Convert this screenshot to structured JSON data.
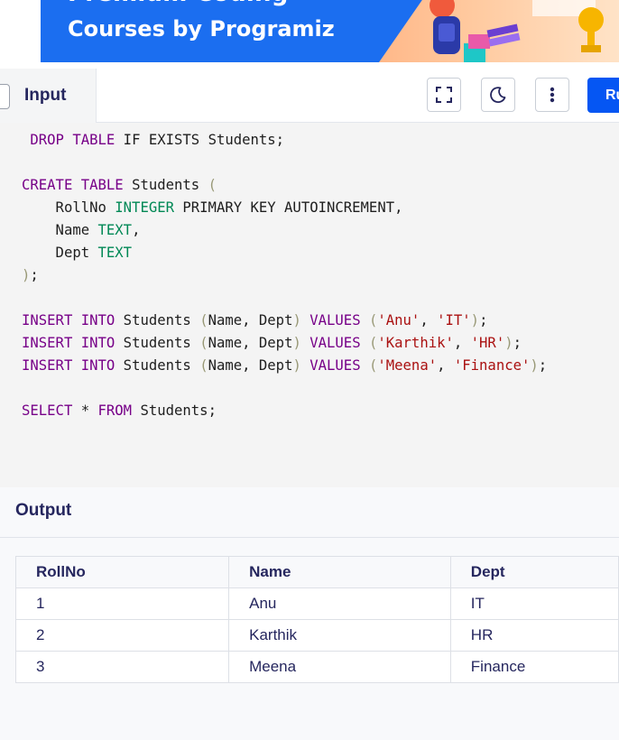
{
  "banner": {
    "text_top": "Premium Coding",
    "text": "Courses by Programiz"
  },
  "tabs": {
    "input_label": "Input"
  },
  "toolbar": {
    "fullscreen_icon": "fullscreen-icon",
    "theme_icon": "moon-icon",
    "menu_icon": "more-vertical-icon",
    "run_label": "Run"
  },
  "editor": {
    "lines": [
      " DROP TABLE IF EXISTS Students;",
      "",
      "CREATE TABLE Students (",
      "    RollNo INTEGER PRIMARY KEY AUTOINCREMENT,",
      "    Name TEXT,",
      "    Dept TEXT",
      ");",
      "",
      "INSERT INTO Students (Name, Dept) VALUES ('Anu', 'IT');",
      "INSERT INTO Students (Name, Dept) VALUES ('Karthik', 'HR');",
      "INSERT INTO Students (Name, Dept) VALUES ('Meena', 'Finance');",
      "",
      "SELECT * FROM Students;"
    ]
  },
  "output": {
    "title": "Output",
    "columns": [
      "RollNo",
      "Name",
      "Dept"
    ],
    "rows": [
      [
        "1",
        "Anu",
        "IT"
      ],
      [
        "2",
        "Karthik",
        "HR"
      ],
      [
        "3",
        "Meena",
        "Finance"
      ]
    ]
  },
  "colors": {
    "banner": "#1b6ef0",
    "accent": "#0556f3",
    "heading": "#25265e",
    "keyword": "#770088",
    "type": "#008855",
    "string": "#aa1111"
  }
}
